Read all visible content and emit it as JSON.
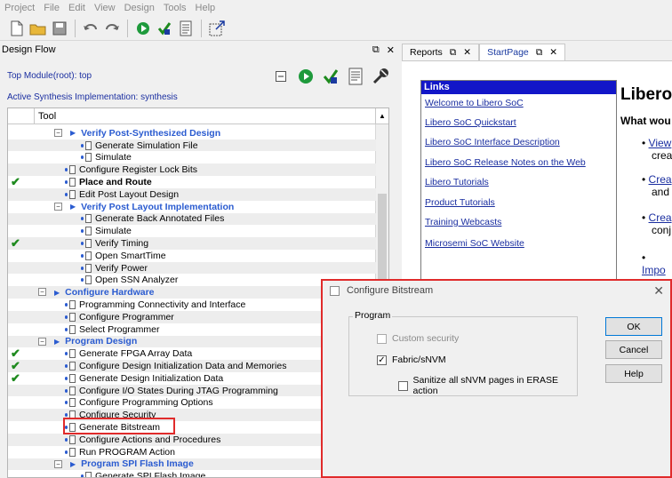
{
  "menu": [
    "Project",
    "File",
    "Edit",
    "View",
    "Design",
    "Tools",
    "Help"
  ],
  "design_flow": {
    "title": "Design Flow",
    "top_module": "Top Module(root): top",
    "active_synthesis": "Active Synthesis Implementation: synthesis",
    "tool_header": "Tool",
    "rows": [
      {
        "label": "Verify Post-Synthesized Design",
        "type": "section2"
      },
      {
        "label": "Generate Simulation File",
        "type": "item3"
      },
      {
        "label": "Simulate",
        "type": "item3"
      },
      {
        "label": "Configure Register Lock Bits",
        "type": "item2"
      },
      {
        "label": "Place and Route",
        "type": "item2",
        "checked": true,
        "bold": true
      },
      {
        "label": "Edit Post Layout Design",
        "type": "item2"
      },
      {
        "label": "Verify Post Layout Implementation",
        "type": "section2"
      },
      {
        "label": "Generate Back Annotated Files",
        "type": "item3"
      },
      {
        "label": "Simulate",
        "type": "item3"
      },
      {
        "label": "Verify Timing",
        "type": "item3",
        "checked": true
      },
      {
        "label": "Open SmartTime",
        "type": "item3"
      },
      {
        "label": "Verify Power",
        "type": "item3"
      },
      {
        "label": "Open SSN Analyzer",
        "type": "item3"
      },
      {
        "label": "Configure Hardware",
        "type": "section1"
      },
      {
        "label": "Programming Connectivity and Interface",
        "type": "item2"
      },
      {
        "label": "Configure Programmer",
        "type": "item2"
      },
      {
        "label": "Select Programmer",
        "type": "item2"
      },
      {
        "label": "Program Design",
        "type": "section1"
      },
      {
        "label": "Generate FPGA Array Data",
        "type": "item2",
        "checked": true
      },
      {
        "label": "Configure Design Initialization Data and Memories",
        "type": "item2",
        "checked": true
      },
      {
        "label": "Generate Design Initialization Data",
        "type": "item2",
        "checked": true
      },
      {
        "label": "Configure I/O States During JTAG Programming",
        "type": "item2"
      },
      {
        "label": "Configure Programming Options",
        "type": "item2"
      },
      {
        "label": "Configure Security",
        "type": "item2"
      },
      {
        "label": "Generate Bitstream",
        "type": "item2",
        "highlighted": true
      },
      {
        "label": "Configure Actions and Procedures",
        "type": "item2"
      },
      {
        "label": "Run PROGRAM Action",
        "type": "item2"
      },
      {
        "label": "Program SPI Flash Image",
        "type": "section2"
      },
      {
        "label": "Generate SPI Flash Image",
        "type": "item3"
      }
    ]
  },
  "tabs": [
    {
      "label": "Reports"
    },
    {
      "label": "StartPage"
    }
  ],
  "start_page": {
    "links_title": "Links",
    "links": [
      "Welcome to Libero SoC",
      "Libero SoC Quickstart",
      "Libero SoC Interface Description",
      "Libero SoC Release Notes on the Web",
      "Libero Tutorials",
      "Product Tutorials",
      "Training Webcasts",
      "Microsemi SoC Website"
    ],
    "heading": "Libero",
    "question": "What wou",
    "bullets": [
      {
        "link": "View",
        "rest": "crea"
      },
      {
        "link": "Crea",
        "rest": "and"
      },
      {
        "link": "Crea",
        "rest": "conj"
      },
      {
        "link": "Impo",
        "rest": ""
      }
    ]
  },
  "dialog": {
    "title": "Configure Bitstream",
    "group_label": "Program",
    "custom_security": "Custom security",
    "fabric": "Fabric/sNVM",
    "sanitize": "Sanitize all  sNVM pages in ERASE action",
    "ok": "OK",
    "cancel": "Cancel",
    "help": "Help"
  }
}
